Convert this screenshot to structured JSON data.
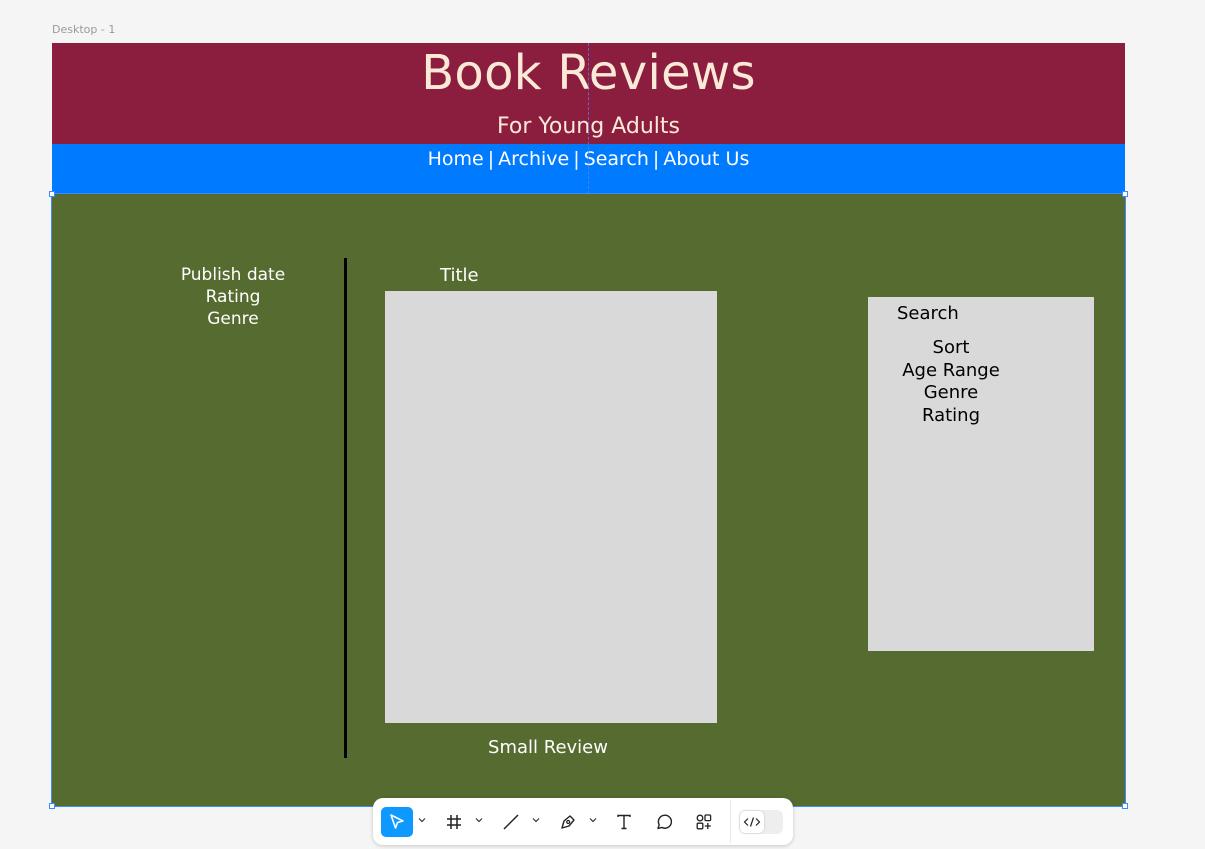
{
  "canvas": {
    "frame_label": "Desktop - 1"
  },
  "header": {
    "title": "Book Reviews",
    "subtitle": "For Young Adults"
  },
  "nav": {
    "items": [
      {
        "label": "Home"
      },
      {
        "label": "Archive"
      },
      {
        "label": "Search"
      },
      {
        "label": "About Us"
      }
    ],
    "separator": "|"
  },
  "main": {
    "meta": [
      "Publish date",
      "Rating",
      "Genre"
    ],
    "card": {
      "title": "Title",
      "review": "Small Review"
    },
    "side_panel": {
      "search_label": "Search",
      "filters": [
        "Sort",
        "Age Range",
        "Genre",
        "Rating"
      ]
    }
  },
  "toolbar": {
    "tools": [
      {
        "icon": "move-cursor-icon",
        "active": true,
        "has_menu": true
      },
      {
        "icon": "frame-icon",
        "has_menu": true
      },
      {
        "icon": "line-icon",
        "has_menu": true
      },
      {
        "icon": "pen-icon",
        "has_menu": true
      },
      {
        "icon": "text-icon"
      },
      {
        "icon": "comment-icon"
      },
      {
        "icon": "components-icon"
      },
      {
        "icon": "dev-mode-icon"
      }
    ]
  },
  "colors": {
    "header_bg": "#8b1e3f",
    "nav_bg": "#007bff",
    "main_bg": "#566b30",
    "placeholder": "#d9d9d9",
    "header_text": "#fbe9d8",
    "selection": "#3d8bfd",
    "tool_active": "#0d99ff"
  }
}
